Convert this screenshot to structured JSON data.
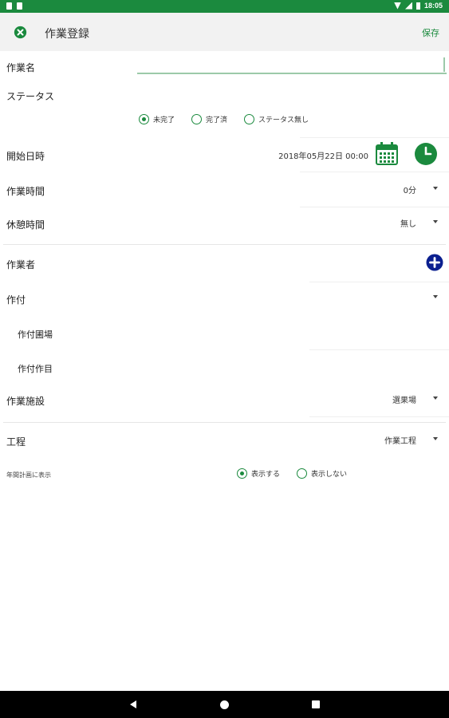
{
  "status_bar": {
    "time": "18:05"
  },
  "app_bar": {
    "title": "作業登録",
    "save_label": "保存"
  },
  "form": {
    "work_name": {
      "label": "作業名",
      "value": ""
    },
    "status": {
      "label": "ステータス",
      "options": [
        "未完了",
        "完了済",
        "ステータス無し"
      ],
      "selected": "未完了"
    },
    "start_datetime": {
      "label": "開始日時",
      "value": "2018年05月22日 00:00"
    },
    "work_time": {
      "label": "作業時間",
      "value": "0分"
    },
    "break_time": {
      "label": "休憩時間",
      "value": "無し"
    },
    "worker": {
      "label": "作業者"
    },
    "planting": {
      "label": "作付"
    },
    "planting_field": {
      "label": "作付圃場"
    },
    "planting_item": {
      "label": "作付作目"
    },
    "facility": {
      "label": "作業施設",
      "value": "選果場"
    },
    "process": {
      "label": "工程",
      "value": "作業工程"
    },
    "annual_plan": {
      "label": "年間計画に表示",
      "options": [
        "表示する",
        "表示しない"
      ],
      "selected": "表示する"
    }
  },
  "icons": {
    "close": "close-circle-icon",
    "calendar": "calendar-icon",
    "clock": "clock-icon",
    "add": "add-circle-icon"
  },
  "colors": {
    "accent": "#1b8a3e",
    "add_button": "#0b1f8f"
  }
}
